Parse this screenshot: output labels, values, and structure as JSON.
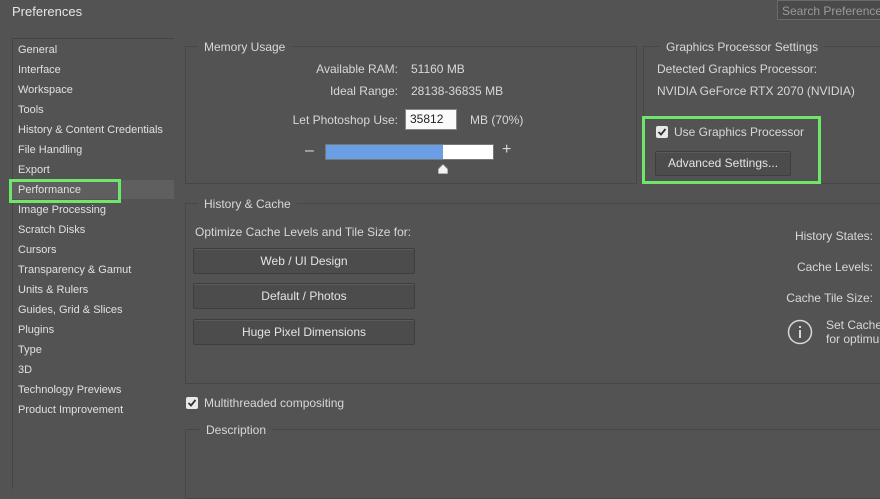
{
  "window": {
    "title": "Preferences"
  },
  "search": {
    "placeholder": "Search Preferences"
  },
  "sidebar": {
    "items": [
      {
        "label": "General"
      },
      {
        "label": "Interface"
      },
      {
        "label": "Workspace"
      },
      {
        "label": "Tools"
      },
      {
        "label": "History & Content Credentials"
      },
      {
        "label": "File Handling"
      },
      {
        "label": "Export"
      },
      {
        "label": "Performance"
      },
      {
        "label": "Image Processing"
      },
      {
        "label": "Scratch Disks"
      },
      {
        "label": "Cursors"
      },
      {
        "label": "Transparency & Gamut"
      },
      {
        "label": "Units & Rulers"
      },
      {
        "label": "Guides, Grid & Slices"
      },
      {
        "label": "Plugins"
      },
      {
        "label": "Type"
      },
      {
        "label": "3D"
      },
      {
        "label": "Technology Previews"
      },
      {
        "label": "Product Improvement"
      }
    ],
    "selected": "Performance"
  },
  "memory": {
    "title": "Memory Usage",
    "available_label": "Available RAM:",
    "available_value": "51160 MB",
    "ideal_label": "Ideal Range:",
    "ideal_value": "28138-36835 MB",
    "let_label": "Let Photoshop Use:",
    "let_value": "35812",
    "let_unit": "MB (70%)",
    "minus": "–",
    "plus": "+",
    "slider_fraction": 0.7
  },
  "gpu": {
    "title": "Graphics Processor Settings",
    "detected_label": "Detected Graphics Processor:",
    "detected_value": "NVIDIA GeForce RTX 2070 (NVIDIA)",
    "use_label": "Use Graphics Processor",
    "use_checked": true,
    "advanced_button": "Advanced Settings..."
  },
  "history": {
    "title": "History & Cache",
    "optimize_label": "Optimize Cache Levels and Tile Size for:",
    "buttons": [
      "Web / UI Design",
      "Default / Photos",
      "Huge Pixel Dimensions"
    ],
    "states_label": "History States:",
    "levels_label": "Cache Levels:",
    "tile_label": "Cache Tile Size:",
    "info_line1": "Set Cache",
    "info_line2": "for optimu"
  },
  "multithreaded": {
    "label": "Multithreaded compositing",
    "checked": true
  },
  "description": {
    "title": "Description"
  },
  "colors": {
    "highlight": "#6fe66a",
    "slider_fill": "#6a9fe6",
    "background": "#535353"
  }
}
